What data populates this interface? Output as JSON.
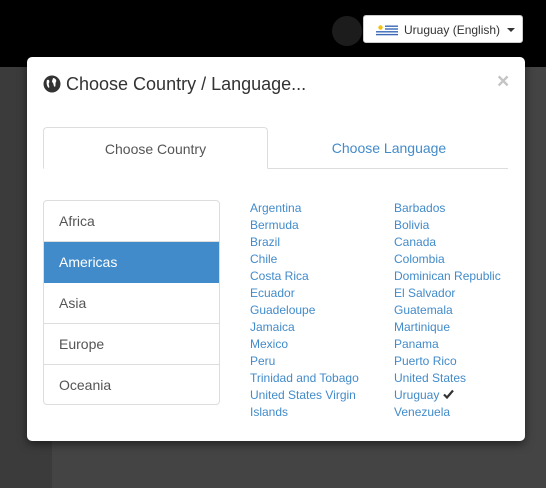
{
  "header": {
    "country_selector": {
      "label": "Uruguay (English)",
      "flag_icon": "uruguay-flag-icon"
    }
  },
  "modal": {
    "title": "Choose Country / Language...",
    "close_label": "×",
    "tabs": [
      {
        "label": "Choose Country",
        "active": true
      },
      {
        "label": "Choose Language",
        "active": false
      }
    ],
    "regions": [
      {
        "label": "Africa",
        "active": false
      },
      {
        "label": "Americas",
        "active": true
      },
      {
        "label": "Asia",
        "active": false
      },
      {
        "label": "Europe",
        "active": false
      },
      {
        "label": "Oceania",
        "active": false
      }
    ],
    "countries_col1": [
      "Argentina",
      "Bermuda",
      "Brazil",
      "Chile",
      "Costa Rica",
      "Ecuador",
      "Guadeloupe",
      "Jamaica",
      "Mexico",
      "Peru",
      "Trinidad and Tobago",
      "United States Virgin Islands"
    ],
    "countries_col2": [
      "Barbados",
      "Bolivia",
      "Canada",
      "Colombia",
      "Dominican Republic",
      "El Salvador",
      "Guatemala",
      "Martinique",
      "Panama",
      "Puerto Rico",
      "United States",
      "Uruguay",
      "Venezuela"
    ],
    "selected_country": "Uruguay",
    "colors": {
      "link": "#428bca",
      "active_bg": "#428bca"
    }
  }
}
